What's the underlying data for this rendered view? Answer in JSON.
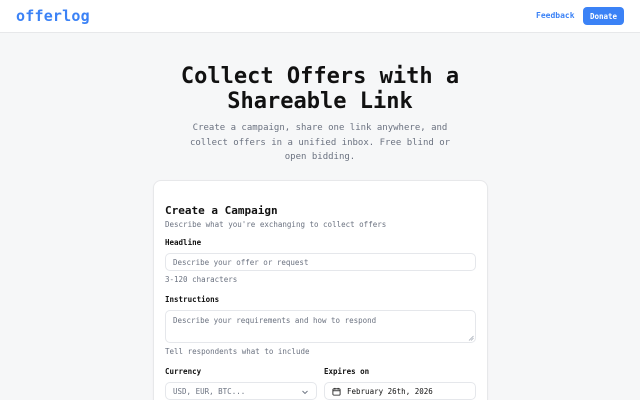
{
  "header": {
    "logo": "offerlog",
    "feedback_label": "Feedback",
    "donate_label": "Donate"
  },
  "hero": {
    "title": "Collect Offers with a Shareable Link",
    "subtitle": "Create a campaign, share one link anywhere, and collect offers in a unified inbox. Free blind or open bidding."
  },
  "form": {
    "title": "Create a Campaign",
    "description": "Describe what you're exchanging to collect offers",
    "headline": {
      "label": "Headline",
      "placeholder": "Describe your offer or request",
      "value": "",
      "hint": "3-120 characters"
    },
    "instructions": {
      "label": "Instructions",
      "placeholder": "Describe your requirements and how to respond",
      "value": "",
      "hint": "Tell respondents what to include"
    },
    "currency": {
      "label": "Currency",
      "placeholder": "USD, EUR, BTC..."
    },
    "expires": {
      "label": "Expires on",
      "value": "February 26th, 2026"
    }
  },
  "colors": {
    "accent": "#3b82f6",
    "background": "#f6f7f8",
    "muted_text": "#6b7280"
  },
  "icons": {
    "currency_dropdown": "chevron-down-icon",
    "expires_picker": "calendar-icon",
    "textarea_resize": "resize-grip-icon"
  }
}
